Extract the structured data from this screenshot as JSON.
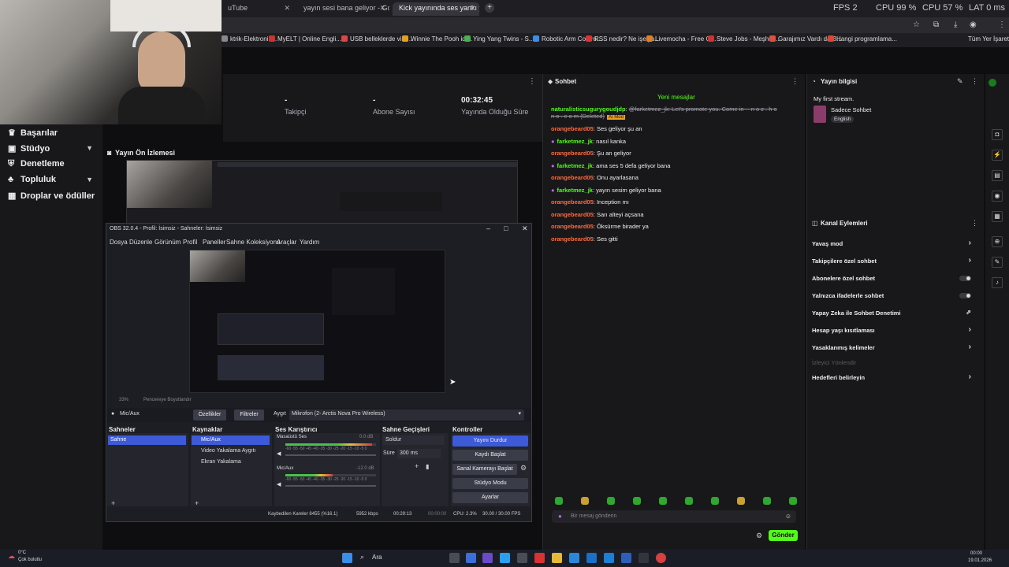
{
  "browser": {
    "tabs": [
      {
        "label": "uTube"
      },
      {
        "label": "yayın sesi bana geliyor - Googl"
      },
      {
        "label": "Kick yayınında ses yankı yapıyo"
      }
    ],
    "stats": {
      "fps": "FPS   2",
      "cpu": "CPU 99 %",
      "cpu2": "CPU 57 %",
      "lat": "LAT 0 ms"
    },
    "bookmarks": [
      "ktrik-Elektronik...",
      "MyELT | Online Engli...",
      "USB bellekler...",
      "USB belleklerde virü...",
      "Winnie The Pooh idi...",
      "Ying Yang Twins - S...",
      "Robotic Arm Contro...",
      "RSS nedir? Ne işe ya...",
      "Livemocha - Free O...",
      "Steve Jobs - Meşhur...",
      "Garajımız Vardı da B...",
      "Hangi programlama..."
    ],
    "all_bookmarks": "Tüm Yer İşaretleri"
  },
  "nav": {
    "items": [
      {
        "label": "Başarılar",
        "icon": "trophy-icon"
      },
      {
        "label": "Stüdyo",
        "icon": "studio-icon"
      },
      {
        "label": "Denetleme",
        "icon": "shield-icon"
      },
      {
        "label": "Topluluk",
        "icon": "community-icon"
      },
      {
        "label": "Droplar ve ödüller",
        "icon": "gift-icon"
      }
    ]
  },
  "stream_stats": [
    {
      "value": "-",
      "label": "Takipçi"
    },
    {
      "value": "-",
      "label": "Abone Sayısı"
    },
    {
      "value": "00:32:45",
      "label": "Yayında Olduğu Süre"
    }
  ],
  "preview": {
    "title": "Yayın Ön İzlemesi"
  },
  "obs": {
    "title": "OBS 32.0.4 - Profil: İsimsiz - Sahneler: İsimsiz",
    "menu": [
      "Dosya",
      "Düzenle",
      "Görünüm",
      "Profil",
      "Paneller",
      "Sahne Koleksiyonu",
      "Araçlar",
      "Yardım"
    ],
    "source_bar": {
      "mic": "Mic/Aux",
      "properties": "Özellikler",
      "filters": "Filtreler",
      "device_label": "Aygıt",
      "device": "Mikrofon (2- Arctis Nova Pro Wireless)"
    },
    "zoom": "33%",
    "fit": "Pencereye Boyutlandır",
    "docks": {
      "scenes": {
        "title": "Sahneler",
        "items": [
          "Sahne"
        ]
      },
      "sources": {
        "title": "Kaynaklar",
        "items": [
          "Mic/Aux",
          "Video Yakalama Aygıtı",
          "Ekran Yakalama"
        ]
      },
      "mixer": {
        "title": "Ses Karıştırıcı",
        "ch1": "Masaüstü Ses",
        "ch1_db": "0.0 dB",
        "ch2": "Mic/Aux",
        "ch2_db": "-12.0 dB",
        "ticks": "-60 -55 -50 -45 -40 -35 -30 -25 -20 -15 -10 -5 0"
      },
      "transitions": {
        "title": "Sahne Geçişleri",
        "type": "Soldur",
        "duration_label": "Süre",
        "duration": "300 ms"
      },
      "controls": {
        "title": "Kontroller",
        "stop_stream": "Yayını Durdur",
        "start_record": "Kaydı Başlat",
        "virtual_cam": "Sanal Kamerayı Başlat",
        "studio_mode": "Stüdyo Modu",
        "settings": "Ayarlar"
      }
    },
    "status": {
      "dropped": "Kaybedilen Kareler 8455 (%16.1)",
      "kbps": "5952 kbps",
      "live": "00:29:13",
      "rec": "00:00:00",
      "cpu": "CPU: 2.3%",
      "fps": "30.00 / 30.00 FPS"
    }
  },
  "chat": {
    "title": "Sohbet",
    "new_messages": "Yeni mesajlar",
    "messages": [
      {
        "user": "naturalisticsugurygoudjdp",
        "text": "@farketmez_jk: Let's promote you. Come in -- n o z . h o n o . c o m (Deleted)",
        "badge": "",
        "color": "#53fc18"
      },
      {
        "user": "orangebeard05",
        "text": "Ses geliyor şu an",
        "badge": "",
        "color": "#ff6b3d"
      },
      {
        "user": "farketmez_jk",
        "text": "nasıl kanka",
        "badge": "mic",
        "color": "#53fc18"
      },
      {
        "user": "orangebeard05",
        "text": "Şu an geliyor",
        "badge": "",
        "color": "#ff6b3d"
      },
      {
        "user": "farketmez_jk",
        "text": "ama ses 5 defa geliyor bana",
        "badge": "mic",
        "color": "#53fc18"
      },
      {
        "user": "orangebeard05",
        "text": "Onu ayarlasana",
        "badge": "",
        "color": "#ff6b3d"
      },
      {
        "user": "farketmez_jk",
        "text": "yayın sesim geliyor bana",
        "badge": "mic",
        "color": "#53fc18"
      },
      {
        "user": "orangebeard05",
        "text": "Inception mı",
        "badge": "",
        "color": "#ff6b3d"
      },
      {
        "user": "orangebeard05",
        "text": "Sarı alteyi açsana",
        "badge": "",
        "color": "#ff6b3d"
      },
      {
        "user": "orangebeard05",
        "text": "Öksürme birader ya",
        "badge": "",
        "color": "#ff6b3d"
      },
      {
        "user": "orangebeard05",
        "text": "Ses gitti",
        "badge": "",
        "color": "#ff6b3d"
      }
    ],
    "deleted_tag": "AI Mod",
    "placeholder": "Bir mesaj gönderin",
    "send": "Gönder"
  },
  "stream_info": {
    "title": "Yayın bilgisi",
    "stream_title": "My first stream.",
    "category": "Sadece Sohbet",
    "language": "English"
  },
  "channel_actions": {
    "title": "Kanal Eylemleri",
    "items": [
      {
        "label": "Yavaş mod",
        "control": "arrow"
      },
      {
        "label": "Takipçilere özel sohbet",
        "control": "arrow"
      },
      {
        "label": "Abonelere özel sohbet",
        "control": "toggle"
      },
      {
        "label": "Yalnızca ifadelerle sohbet",
        "control": "toggle"
      },
      {
        "label": "Yapay Zeka ile Sohbet Denetimi",
        "control": "external"
      },
      {
        "label": "Hesap yaşı kısıtlaması",
        "control": "arrow"
      },
      {
        "label": "Yasaklanmış kelimeler",
        "control": "arrow"
      },
      {
        "label": "İzleyici Yönlendir",
        "control": "none"
      },
      {
        "label": "Hedefleri belirleyin",
        "control": "arrow"
      }
    ]
  },
  "taskbar": {
    "weather": "Çok bulutlu",
    "temp": "0°C",
    "search": "Ara",
    "time": "00:00",
    "date": "19.01.2026"
  },
  "colors": {
    "accent": "#53fc18",
    "obs_blue": "#3d5ad9",
    "bg": "#0e0e10"
  }
}
